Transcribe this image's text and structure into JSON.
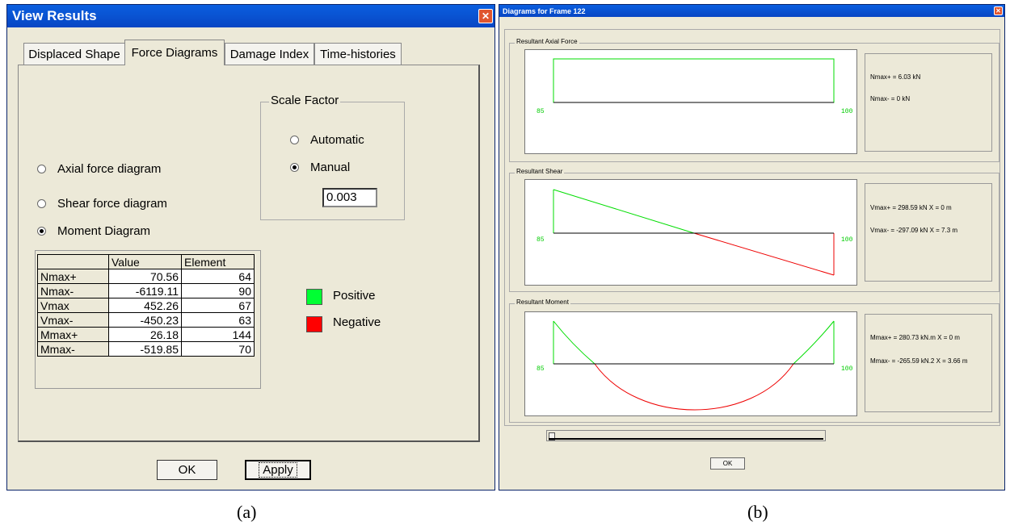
{
  "left_window": {
    "title": "View Results",
    "tabs": [
      {
        "label": "Displaced Shape",
        "active": false
      },
      {
        "label": "Force Diagrams",
        "active": true
      },
      {
        "label": "Damage Index",
        "active": false
      },
      {
        "label": "Time-histories",
        "active": false
      }
    ],
    "diagram_options": {
      "axial": {
        "label": "Axial force diagram",
        "checked": false
      },
      "shear": {
        "label": "Shear force diagram",
        "checked": false
      },
      "moment": {
        "label": "Moment Diagram",
        "checked": true
      }
    },
    "scale_factor": {
      "label": "Scale Factor",
      "automatic": {
        "label": "Automatic",
        "checked": false
      },
      "manual": {
        "label": "Manual",
        "checked": true
      },
      "value": "0.003"
    },
    "table": {
      "columns": [
        "",
        "Value",
        "Element"
      ],
      "rows": [
        {
          "name": "Nmax+",
          "value": "70.56",
          "element": "64"
        },
        {
          "name": "Nmax-",
          "value": "-6119.11",
          "element": "90"
        },
        {
          "name": "Vmax",
          "value": "452.26",
          "element": "67"
        },
        {
          "name": "Vmax-",
          "value": "-450.23",
          "element": "63"
        },
        {
          "name": "Mmax+",
          "value": "26.18",
          "element": "144"
        },
        {
          "name": "Mmax-",
          "value": "-519.85",
          "element": "70"
        }
      ]
    },
    "legend": {
      "positive": {
        "label": "Positive",
        "color": "#00ff33"
      },
      "negative": {
        "label": "Negative",
        "color": "#ff0000"
      }
    },
    "buttons": {
      "ok": "OK",
      "apply": "Apply"
    }
  },
  "right_window": {
    "title": "Diagrams for Frame 122",
    "axial": {
      "label": "Resultant Axial Force",
      "start": "85",
      "end": "100",
      "max_pos": "Nmax+ = 6.03 kN",
      "max_neg": "Nmax- = 0 kN"
    },
    "shear": {
      "label": "Resultant Shear",
      "start": "85",
      "end": "100",
      "max_pos": "Vmax+ = 298.59 kN X = 0 m",
      "max_neg": "Vmax- = -297.09 kN X = 7.3 m"
    },
    "moment": {
      "label": "Resultant Moment",
      "start": "85",
      "end": "100",
      "max_pos": "Mmax+ = 280.73 kN.m X = 0 m",
      "max_neg": "Mmax- = -265.59 kN.2 X = 3.66 m"
    },
    "ok_button": "OK",
    "colors": {
      "positive": "#00dd00",
      "negative": "#ee0000"
    }
  },
  "captions": {
    "a": "(a)",
    "b": "(b)"
  }
}
